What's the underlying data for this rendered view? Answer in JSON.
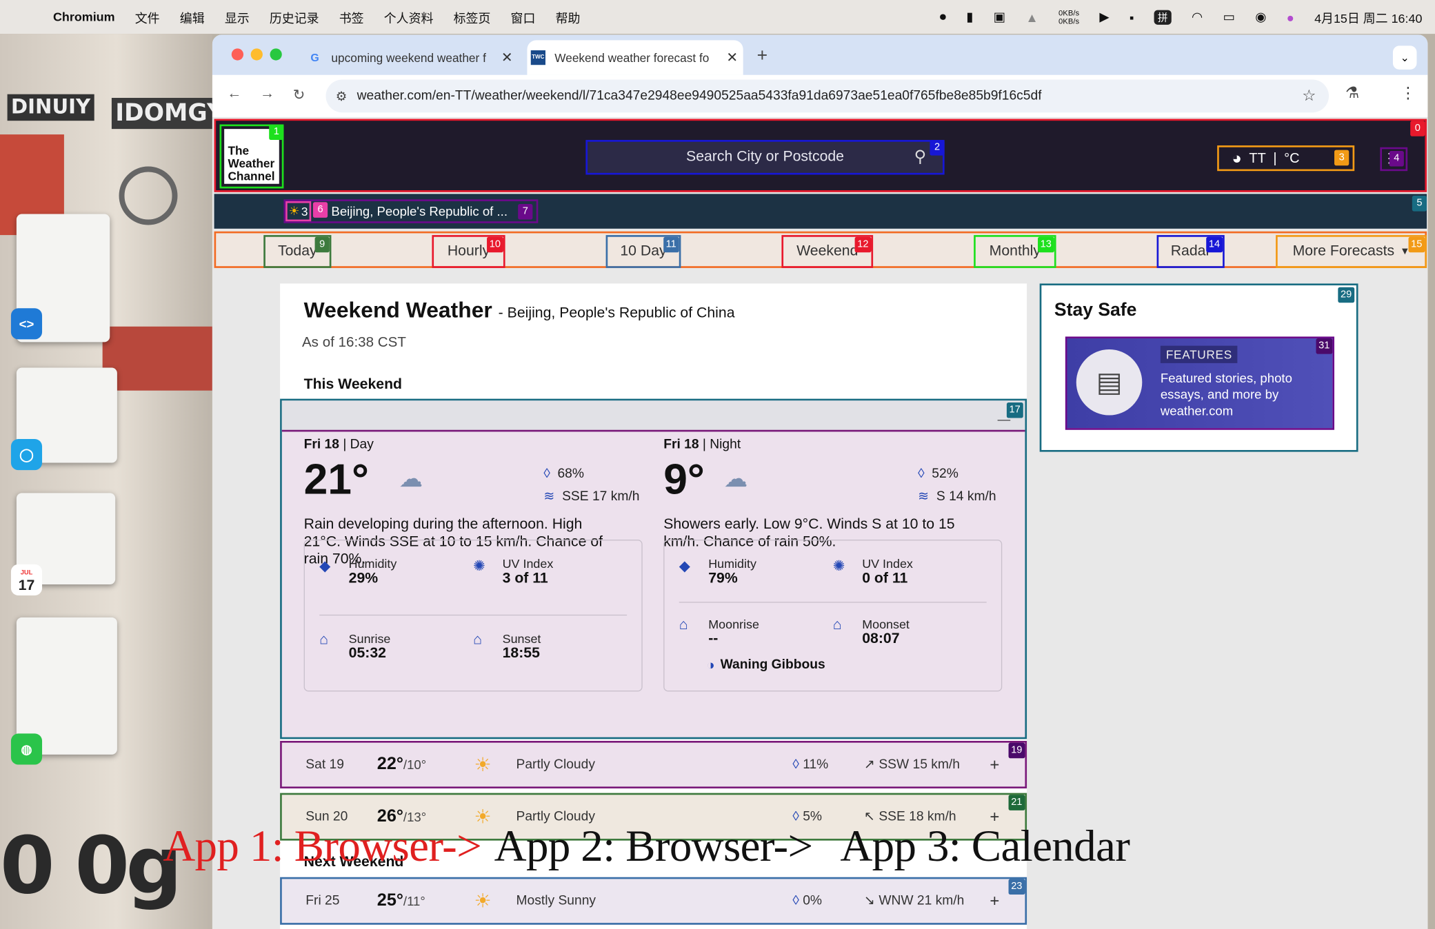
{
  "menubar": {
    "app_name": "Chromium",
    "items": [
      "文件",
      "编辑",
      "显示",
      "历史记录",
      "书签",
      "个人资料",
      "标签页",
      "窗口",
      "帮助"
    ],
    "net_up": "0KB/s",
    "net_down": "0KB/s",
    "clock": "4月15日 周二  16:40"
  },
  "desktop": {
    "poster_left": "DINUIY",
    "poster_right": "IDOMGY",
    "calendar_month": "JUL",
    "calendar_day": "17"
  },
  "browser": {
    "tabs": [
      {
        "title": "upcoming weekend weather f",
        "favicon": "google-icon"
      },
      {
        "title": "Weekend weather forecast fo",
        "favicon": "weather-channel-icon"
      }
    ],
    "url": "weather.com/en-TT/weather/weekend/l/71ca347e2948ee9490525aa5433fa91da6973ae51ea0f765fbe8e85b9f16c5df"
  },
  "header": {
    "logo_text": [
      "The",
      "Weather",
      "Channel"
    ],
    "search_placeholder": "Search City or Postcode",
    "region": "TT",
    "unit": "°C",
    "location_temp": "3",
    "location": "Beijing, People's Republic of ..."
  },
  "forecast_nav": [
    "Today",
    "Hourly",
    "10 Day",
    "Weekend",
    "Monthly",
    "Radar",
    "More Forecasts"
  ],
  "badges": [
    "0",
    "1",
    "2",
    "3",
    "4",
    "5",
    "6",
    "7",
    "9",
    "10",
    "11",
    "12",
    "13",
    "14",
    "15",
    "17",
    "19",
    "21",
    "23",
    "29",
    "31"
  ],
  "page": {
    "title": "Weekend Weather",
    "location_suffix": "- Beijing, People's Republic of China",
    "as_of": "As of 16:38 CST",
    "this_weekend": "This Weekend",
    "next_weekend": "Next Weekend"
  },
  "day": {
    "label_day": "Fri 18",
    "label_part": "| Day",
    "temp": "21°",
    "precip": "68%",
    "wind": "SSE 17 km/h",
    "description": "Rain developing during the afternoon. High 21°C. Winds SSE at 10 to 15 km/h. Chance of rain 70%.",
    "humidity_label": "Humidity",
    "humidity": "29%",
    "uv_label": "UV Index",
    "uv": "3 of 11",
    "sunrise_label": "Sunrise",
    "sunrise": "05:32",
    "sunset_label": "Sunset",
    "sunset": "18:55"
  },
  "night": {
    "label_day": "Fri 18",
    "label_part": "| Night",
    "temp": "9°",
    "precip": "52%",
    "wind": "S 14 km/h",
    "description": "Showers early. Low 9°C. Winds S at 10 to 15 km/h. Chance of rain 50%.",
    "humidity_label": "Humidity",
    "humidity": "79%",
    "uv_label": "UV Index",
    "uv": "0 of 11",
    "moonrise_label": "Moonrise",
    "moonrise": "--",
    "moonset_label": "Moonset",
    "moonset": "08:07",
    "moon_phase": "Waning Gibbous"
  },
  "rows": [
    {
      "day": "Sat 19",
      "high": "22°",
      "low": "/10°",
      "condition": "Partly Cloudy",
      "precip": "11%",
      "wind": "SSW 15 km/h"
    },
    {
      "day": "Sun 20",
      "high": "26°",
      "low": "/13°",
      "condition": "Partly Cloudy",
      "precip": "5%",
      "wind": "SSE 18 km/h"
    },
    {
      "day": "Fri 25",
      "high": "25°",
      "low": "/11°",
      "condition": "Mostly Sunny",
      "precip": "0%",
      "wind": "WNW 21 km/h"
    }
  ],
  "stay_safe": {
    "heading": "Stay Safe",
    "tag": "FEATURES",
    "text": "Featured stories, photo essays, and more by weather.com"
  },
  "caption": {
    "part1": "App 1: Browser->",
    "part2": "App 2: Browser->",
    "part3": "App 3: Calendar"
  },
  "colors": {
    "header_bg": "#1f1a2b",
    "locbar_bg": "#1c3244",
    "expanded_bg": "#ede1ed",
    "caption_red": "#e02020"
  }
}
